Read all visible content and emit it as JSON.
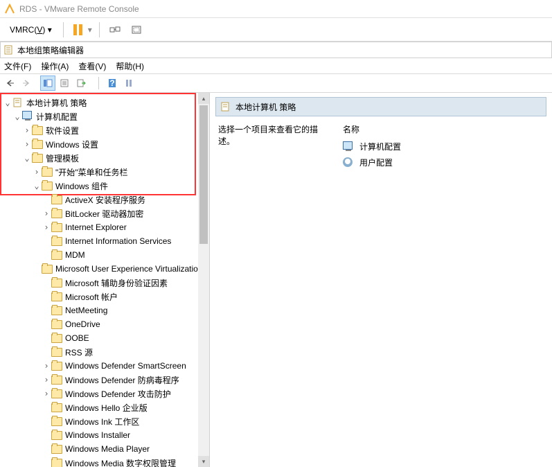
{
  "vmrc": {
    "title": "RDS - VMware Remote Console",
    "menu": {
      "label": "VMRC",
      "key": "V"
    }
  },
  "mmc": {
    "title": "本地组策略编辑器",
    "menu": {
      "file": "文件(F)",
      "action": "操作(A)",
      "view": "查看(V)",
      "help": "帮助(H)"
    }
  },
  "tree": {
    "root": "本地计算机 策略",
    "computerConfig": "计算机配置",
    "software": "软件设置",
    "windowsSettings": "Windows 设置",
    "adminTemplates": "管理模板",
    "startMenu": "\"开始\"菜单和任务栏",
    "windowsComponents": "Windows 组件",
    "items": [
      "ActiveX 安装程序服务",
      "BitLocker 驱动器加密",
      "Internet Explorer",
      "Internet Information Services",
      "MDM",
      "Microsoft User Experience Virtualization",
      "Microsoft 辅助身份验证因素",
      "Microsoft 帐户",
      "NetMeeting",
      "OneDrive",
      "OOBE",
      "RSS 源",
      "Windows Defender SmartScreen",
      "Windows Defender 防病毒程序",
      "Windows Defender 攻击防护",
      "Windows Hello 企业版",
      "Windows Ink 工作区",
      "Windows Installer",
      "Windows Media Player",
      "Windows Media 数字权限管理"
    ]
  },
  "right": {
    "header": "本地计算机 策略",
    "desc": "选择一个项目来查看它的描述。",
    "nameCol": "名称",
    "item1": "计算机配置",
    "item2": "用户配置"
  }
}
